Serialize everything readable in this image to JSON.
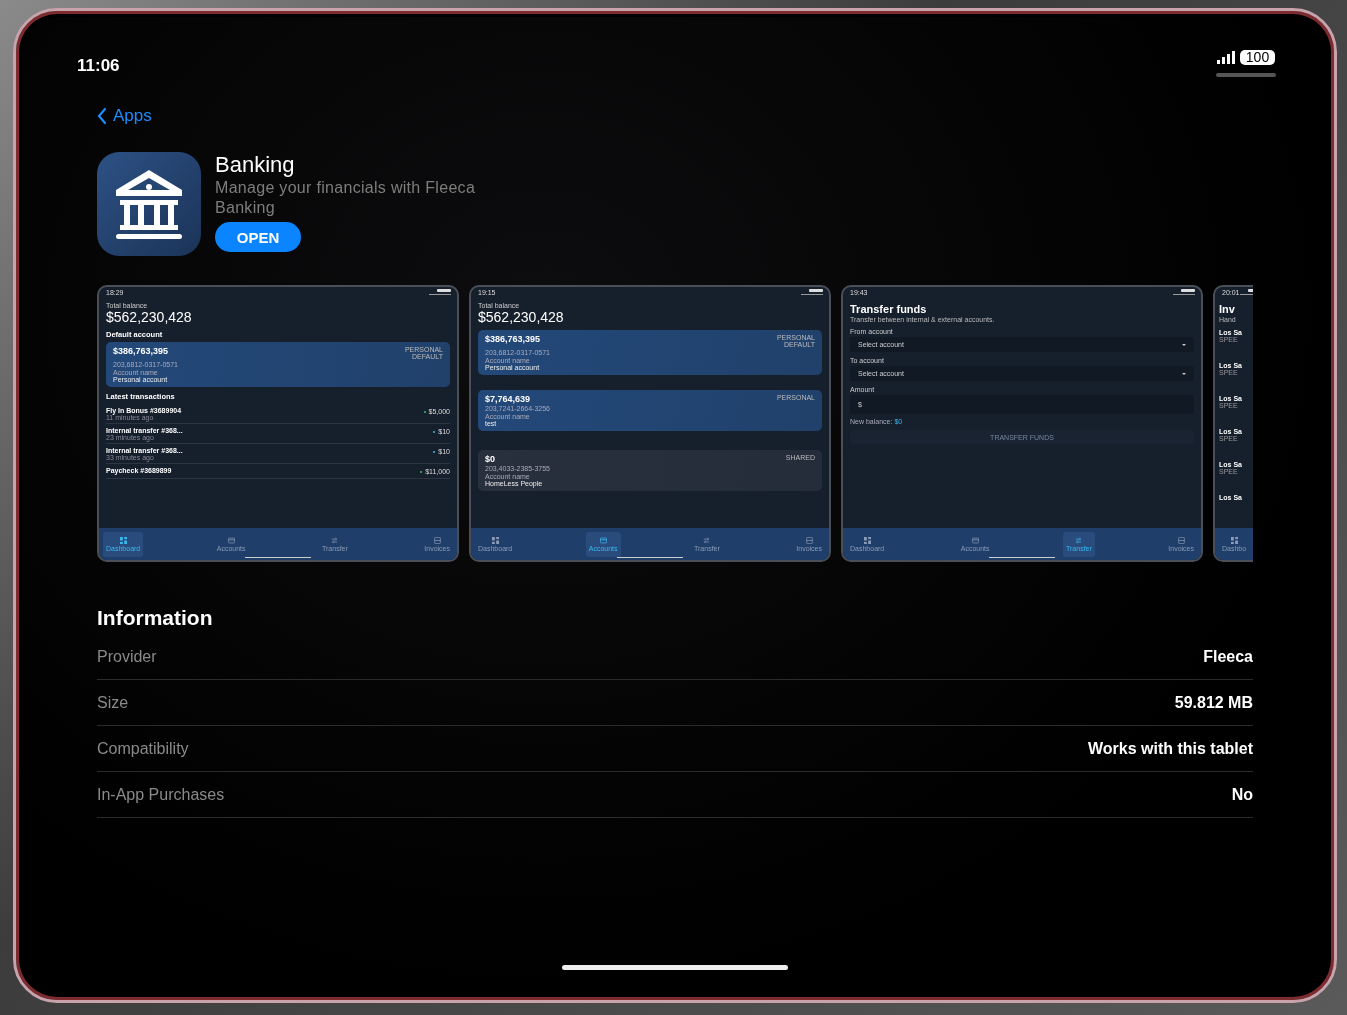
{
  "status_bar": {
    "time": "11:06",
    "battery": "100"
  },
  "back_link": "Apps",
  "app": {
    "name": "Banking",
    "subtitle": "Manage your financials with Fleeca Banking",
    "button": "OPEN"
  },
  "screenshots": [
    {
      "kind": "dashboard",
      "time": "18:29",
      "total_label": "Total balance",
      "total": "$562,230,428",
      "section": "Default account",
      "accounts": [
        {
          "amount": "$386,763,395",
          "tags": [
            "PERSONAL",
            "DEFAULT"
          ],
          "number": "203,6812-0317-0571",
          "name_label": "Account name",
          "name": "Personal account",
          "color": "#23497a"
        }
      ],
      "transactions_title": "Latest transactions",
      "transactions": [
        {
          "title": "Fly In Bonus #3689904",
          "time": "11 minutes ago",
          "amount": "$5,000",
          "kind": "incoming"
        },
        {
          "title": "Internal transfer #368...",
          "time": "23 minutes ago",
          "amount": "$10",
          "kind": "transfer"
        },
        {
          "title": "Internal transfer #368...",
          "time": "33 minutes ago",
          "amount": "$10",
          "kind": "transfer"
        },
        {
          "title": "Paycheck #3689899",
          "amount": "$11,000",
          "kind": "incoming"
        }
      ],
      "nav": [
        {
          "label": "Dashboard",
          "selected": true
        },
        {
          "label": "Accounts",
          "selected": false
        },
        {
          "label": "Transfer",
          "selected": false
        },
        {
          "label": "Invoices",
          "selected": false
        }
      ]
    },
    {
      "kind": "accounts",
      "time": "19:15",
      "total_label": "Total balance",
      "total": "$562,230,428",
      "accounts": [
        {
          "amount": "$386,763,395",
          "tags": [
            "PERSONAL",
            "DEFAULT"
          ],
          "number": "203,6812-0317-0571",
          "name_label": "Account name",
          "name": "Personal account",
          "color": "#23497a"
        },
        {
          "amount": "$7,764,639",
          "tags": [
            "PERSONAL"
          ],
          "number": "203,7241-2664-3256",
          "name_label": "Account name",
          "name": "test",
          "color": "#23497a"
        },
        {
          "amount": "$0",
          "tags": [
            "SHARED"
          ],
          "number": "203,4033-2385-3755",
          "name_label": "Account name",
          "name": "HomeLess People",
          "color": "#28303d"
        }
      ],
      "nav": [
        {
          "label": "Dashboard",
          "selected": false
        },
        {
          "label": "Accounts",
          "selected": true
        },
        {
          "label": "Transfer",
          "selected": false
        },
        {
          "label": "Invoices",
          "selected": false
        }
      ]
    },
    {
      "kind": "transfer",
      "time": "19:43",
      "title": "Transfer funds",
      "subtitle": "Transfer between internal & external accounts.",
      "fields": [
        {
          "label": "From account",
          "placeholder": "Select account",
          "kind": "select"
        },
        {
          "label": "To account",
          "placeholder": "Select account",
          "kind": "select"
        },
        {
          "label": "Amount",
          "placeholder": "$",
          "kind": "input"
        }
      ],
      "balance_label": "New balance:",
      "balance": "$0",
      "button": "TRANSFER FUNDS",
      "button_disabled": true,
      "nav": [
        {
          "label": "Dashboard",
          "selected": false
        },
        {
          "label": "Accounts",
          "selected": false
        },
        {
          "label": "Transfer",
          "selected": true
        },
        {
          "label": "Invoices",
          "selected": false
        }
      ]
    },
    {
      "kind": "invoices",
      "time": "20:01",
      "title": "Inv",
      "subtitle": "Hand",
      "items": [
        {
          "title": "Los Sa",
          "sub": "SPEE"
        },
        {
          "title": "Los Sa",
          "sub": "SPEE"
        },
        {
          "title": "Los Sa",
          "sub": "SPEE"
        },
        {
          "title": "Los Sa",
          "sub": "SPEE"
        },
        {
          "title": "Los Sa",
          "sub": "SPEE"
        },
        {
          "title": "Los Sa"
        }
      ],
      "nav": [
        {
          "label": "Dashbo",
          "selected": false
        }
      ]
    }
  ],
  "information": {
    "title": "Information",
    "rows": [
      {
        "label": "Provider",
        "value": "Fleeca"
      },
      {
        "label": "Size",
        "value": "59.812 MB"
      },
      {
        "label": "Compatibility",
        "value": "Works with this tablet"
      },
      {
        "label": "In-App Purchases",
        "value": "No"
      }
    ]
  }
}
